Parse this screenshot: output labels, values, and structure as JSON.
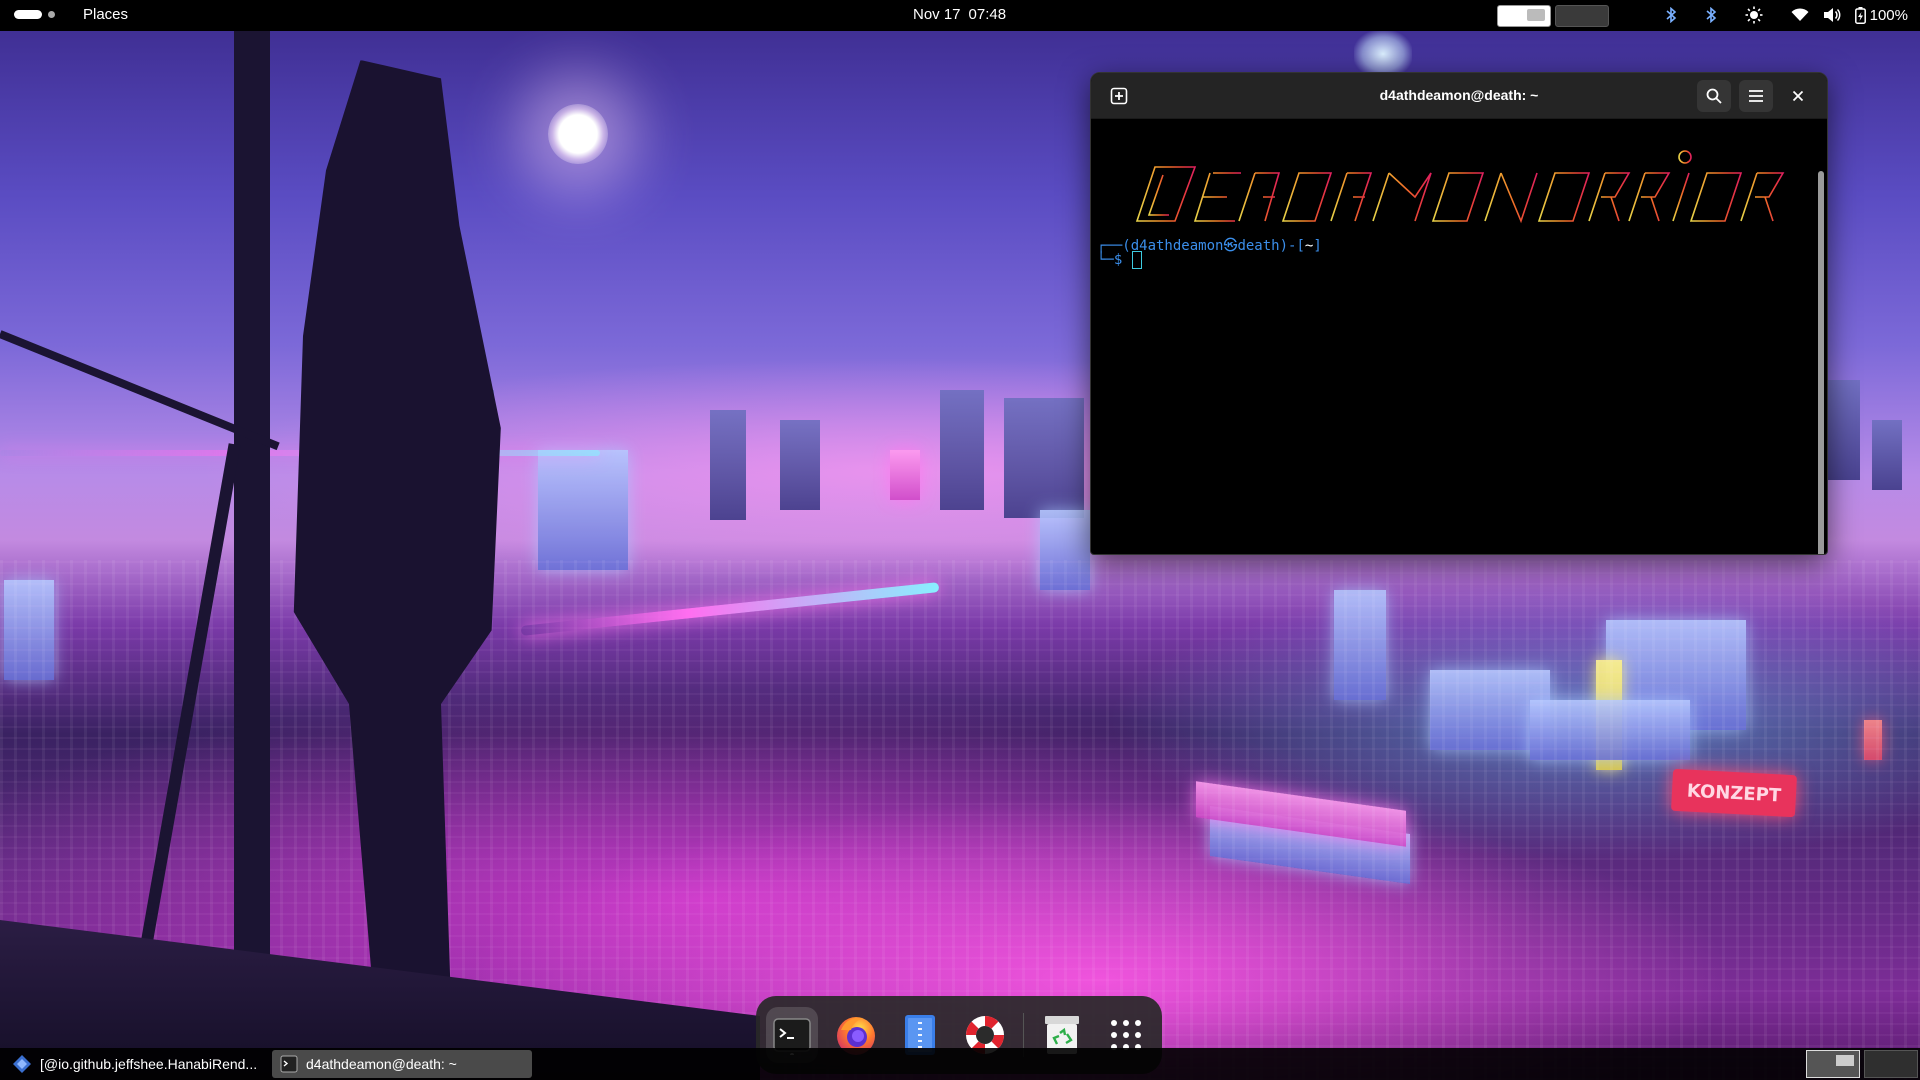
{
  "topbar": {
    "places_label": "Places",
    "date": "Nov 17",
    "time": "07:48",
    "battery": "100%",
    "icons": [
      "bluetooth-icon",
      "bluetooth-icon",
      "night-light-icon",
      "wifi-icon",
      "volume-icon",
      "battery-icon"
    ]
  },
  "terminal": {
    "title": "d4athdeamon@death: ~",
    "prompt_user": "d4athdeamon",
    "prompt_at": "㉿",
    "prompt_host": "death",
    "prompt_dir": "~",
    "prompt_symbol": "$",
    "banner_colors": [
      "#e8d44a",
      "#f0a030",
      "#f07028",
      "#e83c3c",
      "#e02060"
    ]
  },
  "dock": {
    "apps": [
      "terminal",
      "firefox",
      "text-editor",
      "help",
      "trash",
      "show-apps"
    ]
  },
  "taskbar": {
    "tasks": [
      {
        "label": "[@io.github.jeffshee.HanabiRend..."
      },
      {
        "label": "d4athdeamon@death: ~"
      }
    ]
  },
  "wallpaper": {
    "sign_text": "KONZEPT"
  }
}
